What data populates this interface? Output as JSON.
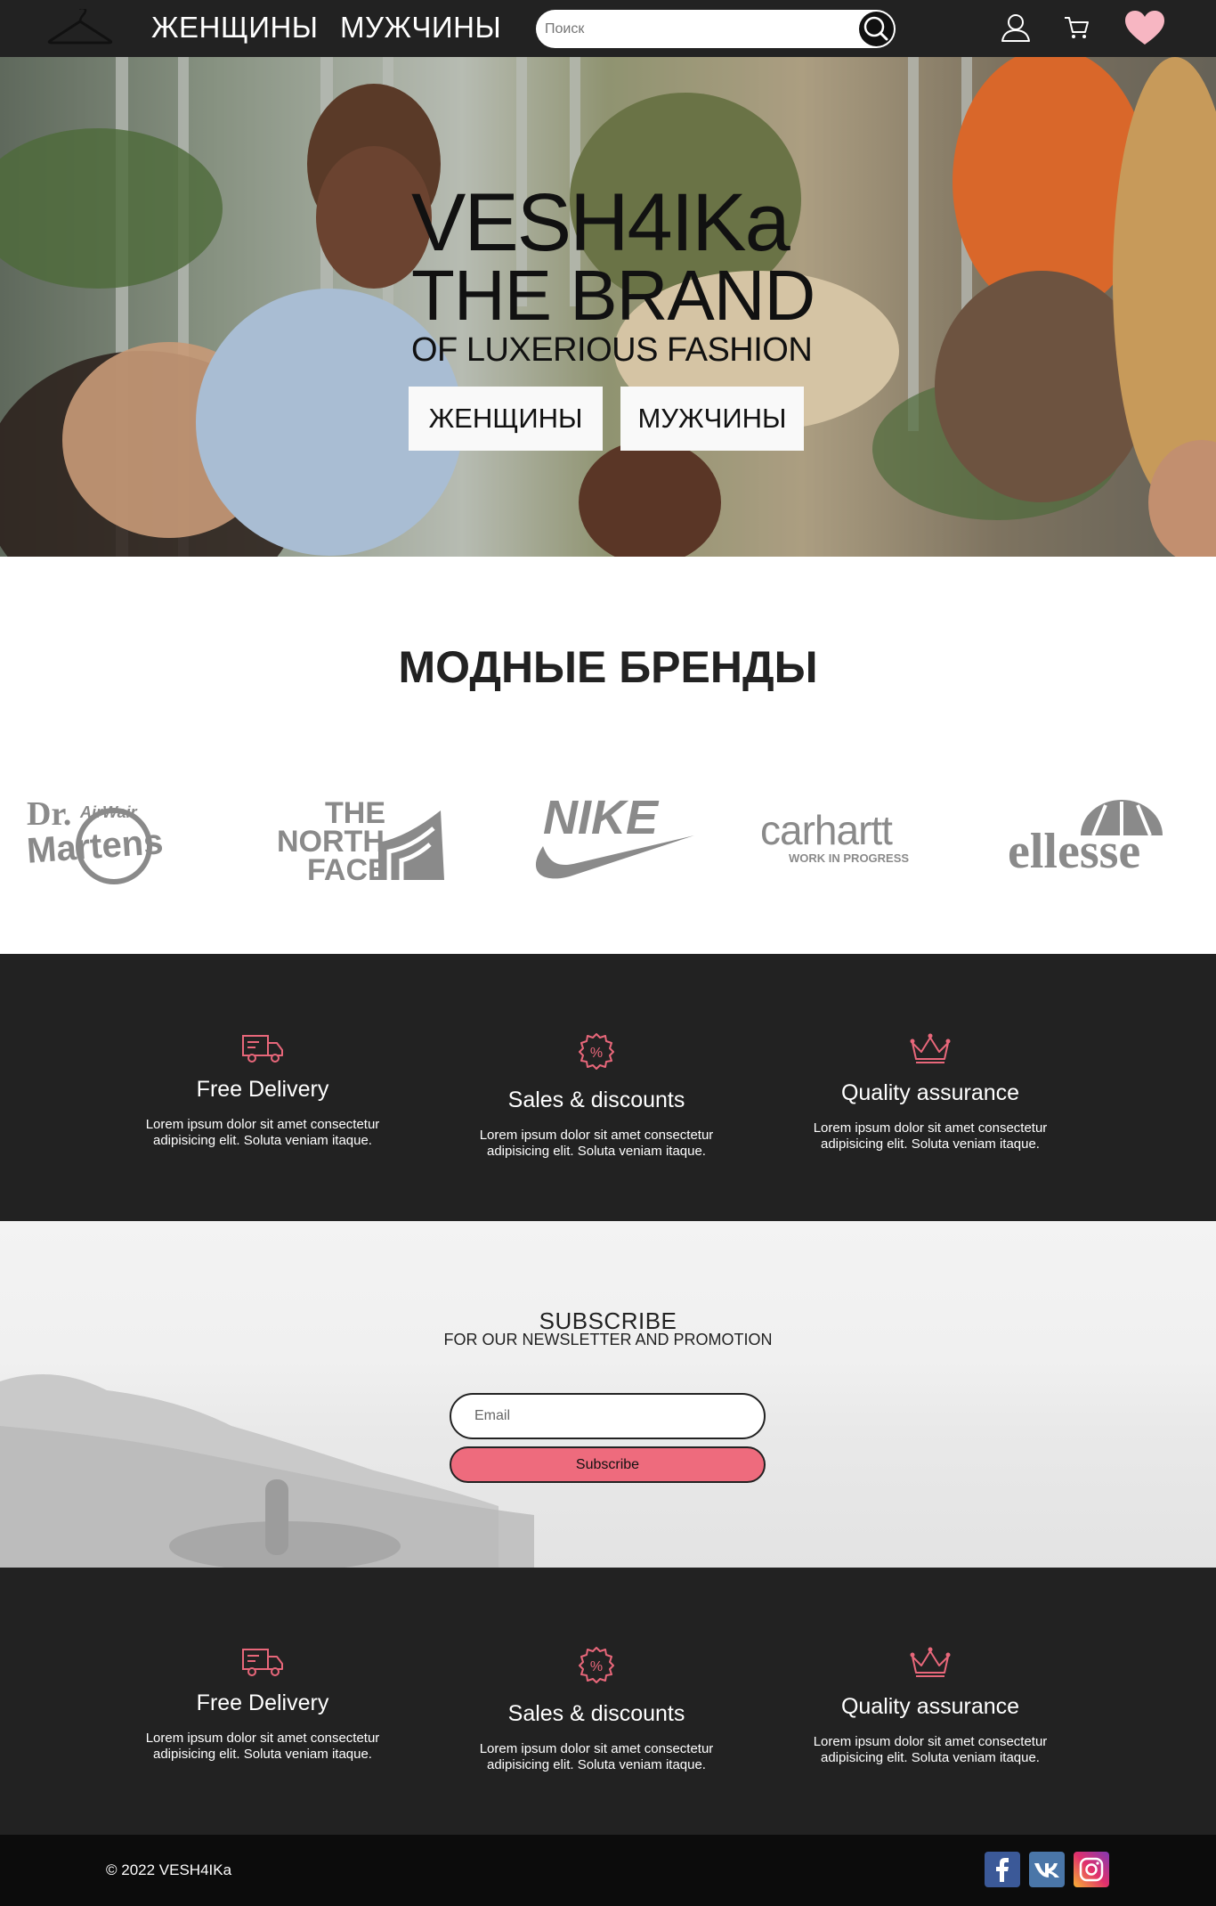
{
  "header": {
    "nav_women": "ЖЕНЩИНЫ",
    "nav_men": "МУЖЧИНЫ",
    "search_placeholder": "Поиск",
    "icons": [
      "hanger-logo-icon",
      "search-icon",
      "user-icon",
      "cart-icon",
      "heart-icon"
    ]
  },
  "hero": {
    "line1": "VESH4IKa",
    "line2": "THE BRAND",
    "line3": "OF LUXERIOUS FASHION",
    "btn_women": "ЖЕНЩИНЫ",
    "btn_men": "МУЖЧИНЫ"
  },
  "brands": {
    "title": "МОДНЫЕ БРЕНДЫ",
    "items": [
      {
        "name": "Dr. Martens",
        "logo_text_1": "Dr.",
        "logo_text_2": "AirWair",
        "logo_text_3": "Martens"
      },
      {
        "name": "The North Face",
        "logo_text_1": "THE",
        "logo_text_2": "NORTH",
        "logo_text_3": "FACE"
      },
      {
        "name": "Nike",
        "logo_text_1": "NIKE"
      },
      {
        "name": "Carhartt",
        "logo_text_1": "carhartt",
        "logo_text_2": "WORK IN PROGRESS"
      },
      {
        "name": "Ellesse",
        "logo_text_1": "ellesse"
      }
    ]
  },
  "features": [
    {
      "icon": "delivery-truck-icon",
      "title": "Free Delivery",
      "text": "Lorem ipsum dolor sit amet consectetur adipisicing elit. Soluta veniam itaque."
    },
    {
      "icon": "discount-badge-icon",
      "title": "Sales & discounts",
      "text": "Lorem ipsum dolor sit amet consectetur adipisicing elit. Soluta veniam itaque."
    },
    {
      "icon": "crown-icon",
      "title": "Quality assurance",
      "text": "Lorem ipsum dolor sit amet consectetur adipisicing elit. Soluta veniam itaque."
    }
  ],
  "subscribe": {
    "title": "SUBSCRIBE",
    "subtitle": "FOR OUR NEWSLETTER AND PROMOTION",
    "email_placeholder": "Email",
    "button": "Subscribe"
  },
  "footer": {
    "copyright": "© 2022 VESH4IKa",
    "social": [
      "facebook-icon",
      "vk-icon",
      "instagram-icon"
    ]
  },
  "colors": {
    "dark_bg": "#222222",
    "footer_bg": "#0c0c0c",
    "accent_pink": "#ee6b7d",
    "heart_pink": "#f7b6c2",
    "brand_gray": "#8a8a8a"
  }
}
